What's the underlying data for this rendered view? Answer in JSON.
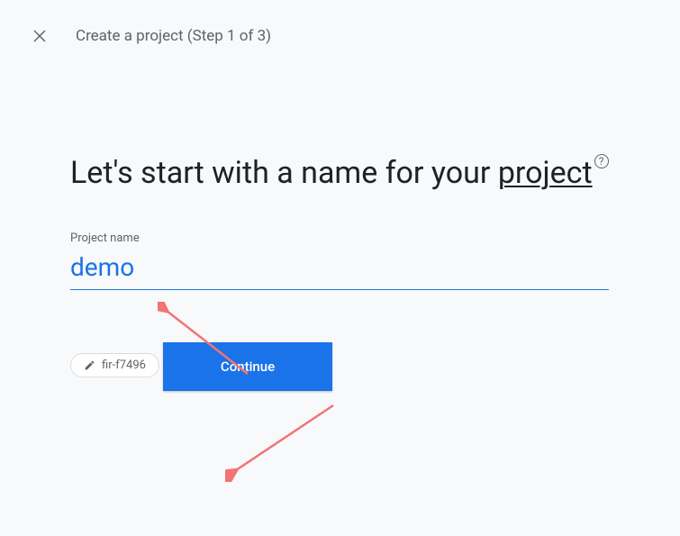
{
  "header": {
    "title": "Create a project (Step 1 of 3)"
  },
  "main": {
    "heading_part1": "Let's start with a name for your ",
    "heading_underlined": "project",
    "field_label": "Project name",
    "project_name_value": "demo",
    "project_id_chip": "fir-f7496",
    "continue_label": "Continue"
  }
}
